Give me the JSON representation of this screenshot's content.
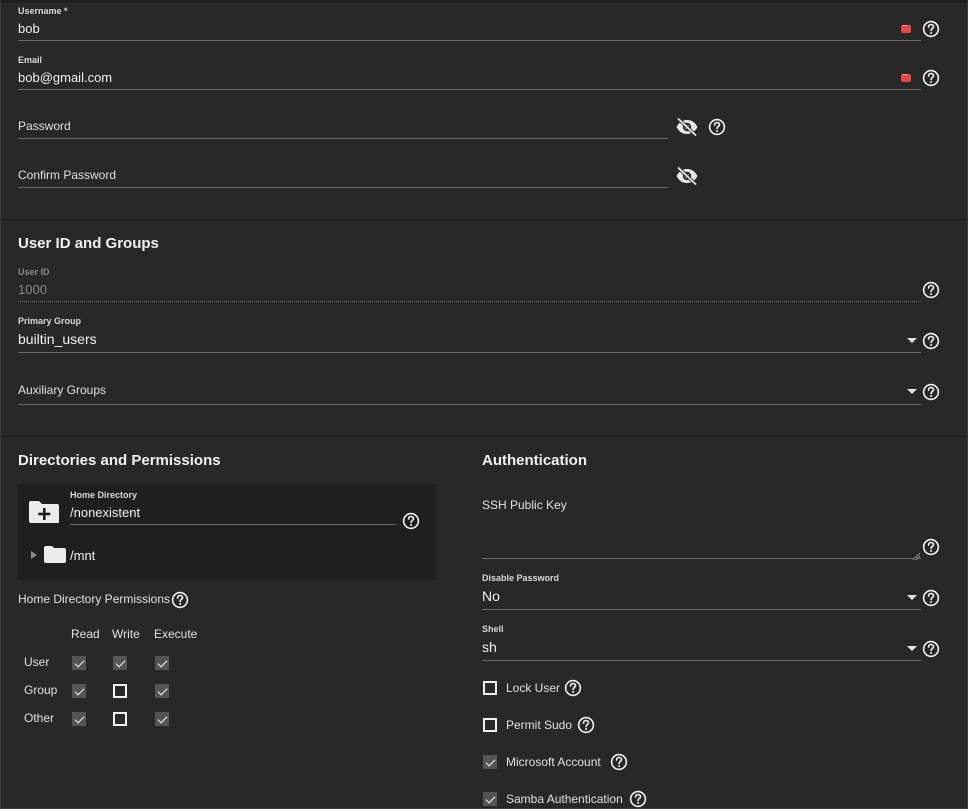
{
  "account": {
    "username_label": "Username *",
    "username_value": "bob",
    "email_label": "Email",
    "email_value": "bob@gmail.com",
    "password_label": "Password",
    "confirm_password_label": "Confirm Password"
  },
  "ids_groups": {
    "title": "User ID and Groups",
    "user_id_label": "User ID",
    "user_id_value": "1000",
    "primary_group_label": "Primary Group",
    "primary_group_value": "builtin_users",
    "auxiliary_groups_label": "Auxiliary Groups"
  },
  "directories": {
    "title": "Directories and Permissions",
    "home_directory_label": "Home Directory",
    "home_directory_value": "/nonexistent",
    "tree_root": "/mnt",
    "permissions_label": "Home Directory Permissions",
    "columns": [
      "Read",
      "Write",
      "Execute"
    ],
    "rows": [
      {
        "name": "User",
        "read": true,
        "write": true,
        "execute": true
      },
      {
        "name": "Group",
        "read": true,
        "write": false,
        "execute": true
      },
      {
        "name": "Other",
        "read": true,
        "write": false,
        "execute": true
      }
    ]
  },
  "authentication": {
    "title": "Authentication",
    "ssh_key_label": "SSH Public Key",
    "disable_password_label": "Disable Password",
    "disable_password_value": "No",
    "shell_label": "Shell",
    "shell_value": "sh",
    "options": [
      {
        "label": "Lock User",
        "checked": false
      },
      {
        "label": "Permit Sudo",
        "checked": false
      },
      {
        "label": "Microsoft Account",
        "checked": true
      },
      {
        "label": "Samba Authentication",
        "checked": true
      }
    ]
  },
  "icons": {
    "help": "help-circle-icon",
    "visibility": "eye-off-icon",
    "folder_add": "folder-plus-icon",
    "folder": "folder-icon",
    "expand": "triangle-right-icon",
    "dropdown": "caret-down-icon",
    "password_manager": "password-manager-icon"
  },
  "colors": {
    "background": "#282828",
    "panel": "#1f1f1f",
    "text": "#e6e6e6",
    "underline": "#6a6a6a",
    "autofill_icon": "#e54848"
  }
}
